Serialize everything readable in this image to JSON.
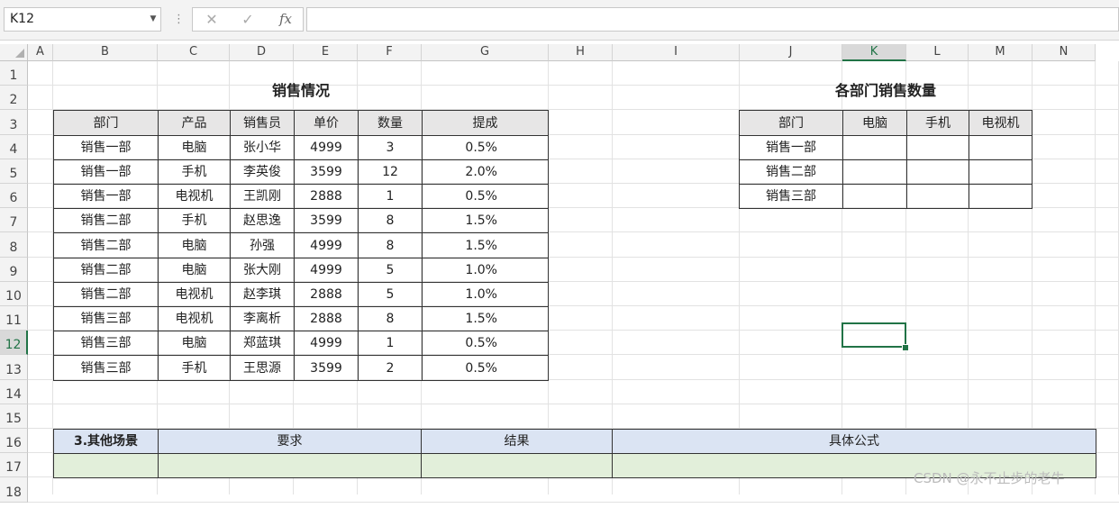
{
  "formula_bar": {
    "name_box": "K12",
    "cancel_icon": "✕",
    "confirm_icon": "✓",
    "fx_icon": "fx",
    "formula": ""
  },
  "columns": [
    "A",
    "B",
    "C",
    "D",
    "E",
    "F",
    "G",
    "H",
    "I",
    "J",
    "K",
    "L",
    "M",
    "N"
  ],
  "rows": [
    "1",
    "2",
    "3",
    "4",
    "5",
    "6",
    "7",
    "8",
    "9",
    "10",
    "11",
    "12",
    "13",
    "14",
    "15",
    "16",
    "17",
    "18"
  ],
  "selected_cell": "K12",
  "sales_table": {
    "title": "销售情况",
    "headers": [
      "部门",
      "产品",
      "销售员",
      "单价",
      "数量",
      "提成"
    ],
    "rows": [
      [
        "销售一部",
        "电脑",
        "张小华",
        "4999",
        "3",
        "0.5%"
      ],
      [
        "销售一部",
        "手机",
        "李英俊",
        "3599",
        "12",
        "2.0%"
      ],
      [
        "销售一部",
        "电视机",
        "王凯刚",
        "2888",
        "1",
        "0.5%"
      ],
      [
        "销售二部",
        "手机",
        "赵思逸",
        "3599",
        "8",
        "1.5%"
      ],
      [
        "销售二部",
        "电脑",
        "孙强",
        "4999",
        "8",
        "1.5%"
      ],
      [
        "销售二部",
        "电脑",
        "张大刚",
        "4999",
        "5",
        "1.0%"
      ],
      [
        "销售二部",
        "电视机",
        "赵李琪",
        "2888",
        "5",
        "1.0%"
      ],
      [
        "销售三部",
        "电视机",
        "李离析",
        "2888",
        "8",
        "1.5%"
      ],
      [
        "销售三部",
        "电脑",
        "郑蓝琪",
        "4999",
        "1",
        "0.5%"
      ],
      [
        "销售三部",
        "手机",
        "王思源",
        "3599",
        "2",
        "0.5%"
      ]
    ]
  },
  "summary_table": {
    "title": "各部门销售数量",
    "headers": [
      "部门",
      "电脑",
      "手机",
      "电视机"
    ],
    "rows": [
      [
        "销售一部",
        "",
        "",
        ""
      ],
      [
        "销售二部",
        "",
        "",
        ""
      ],
      [
        "销售三部",
        "",
        "",
        ""
      ]
    ]
  },
  "scenario_table": {
    "headers": [
      "3.其他场景",
      "要求",
      "结果",
      "具体公式"
    ],
    "row": [
      "",
      "",
      "",
      ""
    ]
  },
  "watermark": "CSDN @永不止步的老牛",
  "colors": {
    "accent": "#217346",
    "header_fill": "#e7e6e6",
    "blue_fill": "#dbe4f3",
    "green_fill": "#e2efda"
  }
}
